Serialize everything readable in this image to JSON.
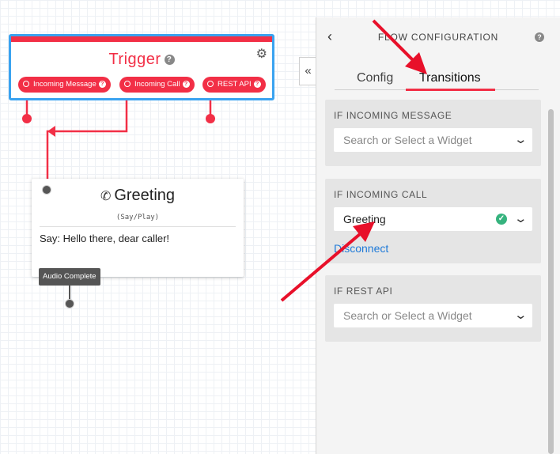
{
  "trigger": {
    "title": "Trigger",
    "help_icon": "question-icon",
    "settings_icon": "gears-icon",
    "pills": [
      {
        "label": "Incoming Message"
      },
      {
        "label": "Incoming Call"
      },
      {
        "label": "REST API"
      }
    ]
  },
  "greeting": {
    "title": "Greeting",
    "icon": "phone-icon",
    "subtitle": "(Say/Play)",
    "body": "Say: Hello there, dear caller!",
    "output_label": "Audio Complete"
  },
  "panel": {
    "title": "FLOW CONFIGURATION",
    "back_icon": "chevron-left-icon",
    "help_icon": "question-icon",
    "collapse_icon": "double-chevron-left-icon",
    "tabs": [
      {
        "label": "Config",
        "active": false
      },
      {
        "label": "Transitions",
        "active": true
      }
    ],
    "sections": [
      {
        "label": "IF INCOMING MESSAGE",
        "select_value": "Search or Select a Widget",
        "is_placeholder": true
      },
      {
        "label": "IF INCOMING CALL",
        "select_value": "Greeting",
        "is_placeholder": false,
        "link": "Disconnect"
      },
      {
        "label": "IF REST API",
        "select_value": "Search or Select a Widget",
        "is_placeholder": true
      }
    ]
  },
  "colors": {
    "accent": "#f22f46",
    "selection_border": "#3aa3f0",
    "link": "#1f7ad8",
    "success": "#36b37e",
    "annotation_arrow": "#e8102a"
  }
}
